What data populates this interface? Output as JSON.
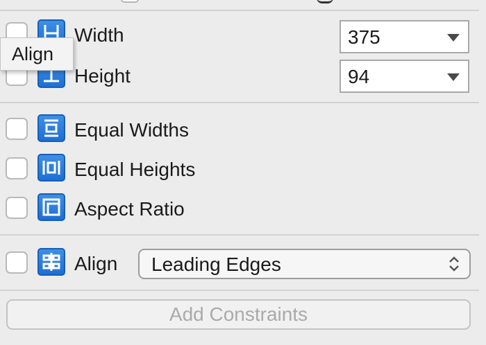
{
  "tooltip": {
    "text": "Align"
  },
  "size": {
    "width": {
      "label": "Width",
      "value": "375",
      "checked": false,
      "icon": "width-constraint-icon"
    },
    "height": {
      "label": "Height",
      "value": "94",
      "checked": false,
      "icon": "height-constraint-icon"
    }
  },
  "equal": {
    "widths": {
      "label": "Equal Widths",
      "checked": false,
      "icon": "equal-widths-icon"
    },
    "heights": {
      "label": "Equal Heights",
      "checked": false,
      "icon": "equal-heights-icon"
    },
    "aspect": {
      "label": "Aspect Ratio",
      "checked": false,
      "icon": "aspect-ratio-icon"
    }
  },
  "align": {
    "label": "Align",
    "selected": "Leading Edges",
    "checked": false,
    "icon": "align-icon"
  },
  "actions": {
    "add_constraints": "Add Constraints",
    "enabled": false
  },
  "colors": {
    "icon_blue": "#2f7fdf",
    "disabled_text": "#aaaaaa"
  }
}
